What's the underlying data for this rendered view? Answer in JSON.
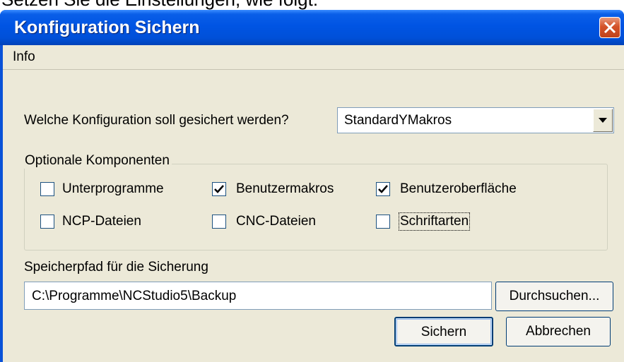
{
  "caption": "Setzen Sie die Einstellungen, wie folgt:",
  "window": {
    "title": "Konfiguration Sichern"
  },
  "menu": {
    "items": [
      "Info"
    ]
  },
  "config": {
    "question": "Welche Konfiguration soll gesichert werden?",
    "selected": "StandardYMakros"
  },
  "components": {
    "legend": "Optionale Komponenten",
    "options": [
      {
        "label": "Unterprogramme",
        "checked": false
      },
      {
        "label": "Benutzermakros",
        "checked": true
      },
      {
        "label": "Benutzeroberfläche",
        "checked": true
      },
      {
        "label": "NCP-Dateien",
        "checked": false
      },
      {
        "label": "CNC-Dateien",
        "checked": false
      },
      {
        "label": "Schriftarten",
        "checked": false
      }
    ]
  },
  "savepath": {
    "label": "Speicherpfad für die Sicherung",
    "value": "C:\\Programme\\NCStudio5\\Backup",
    "browse_label": "Durchsuchen..."
  },
  "actions": {
    "save_label": "Sichern",
    "cancel_label": "Abbrechen"
  },
  "colors": {
    "titlebar": "#0054e3",
    "dialog_bg": "#ece9d8",
    "close_button": "#d4532a",
    "button_border": "#003c74"
  }
}
